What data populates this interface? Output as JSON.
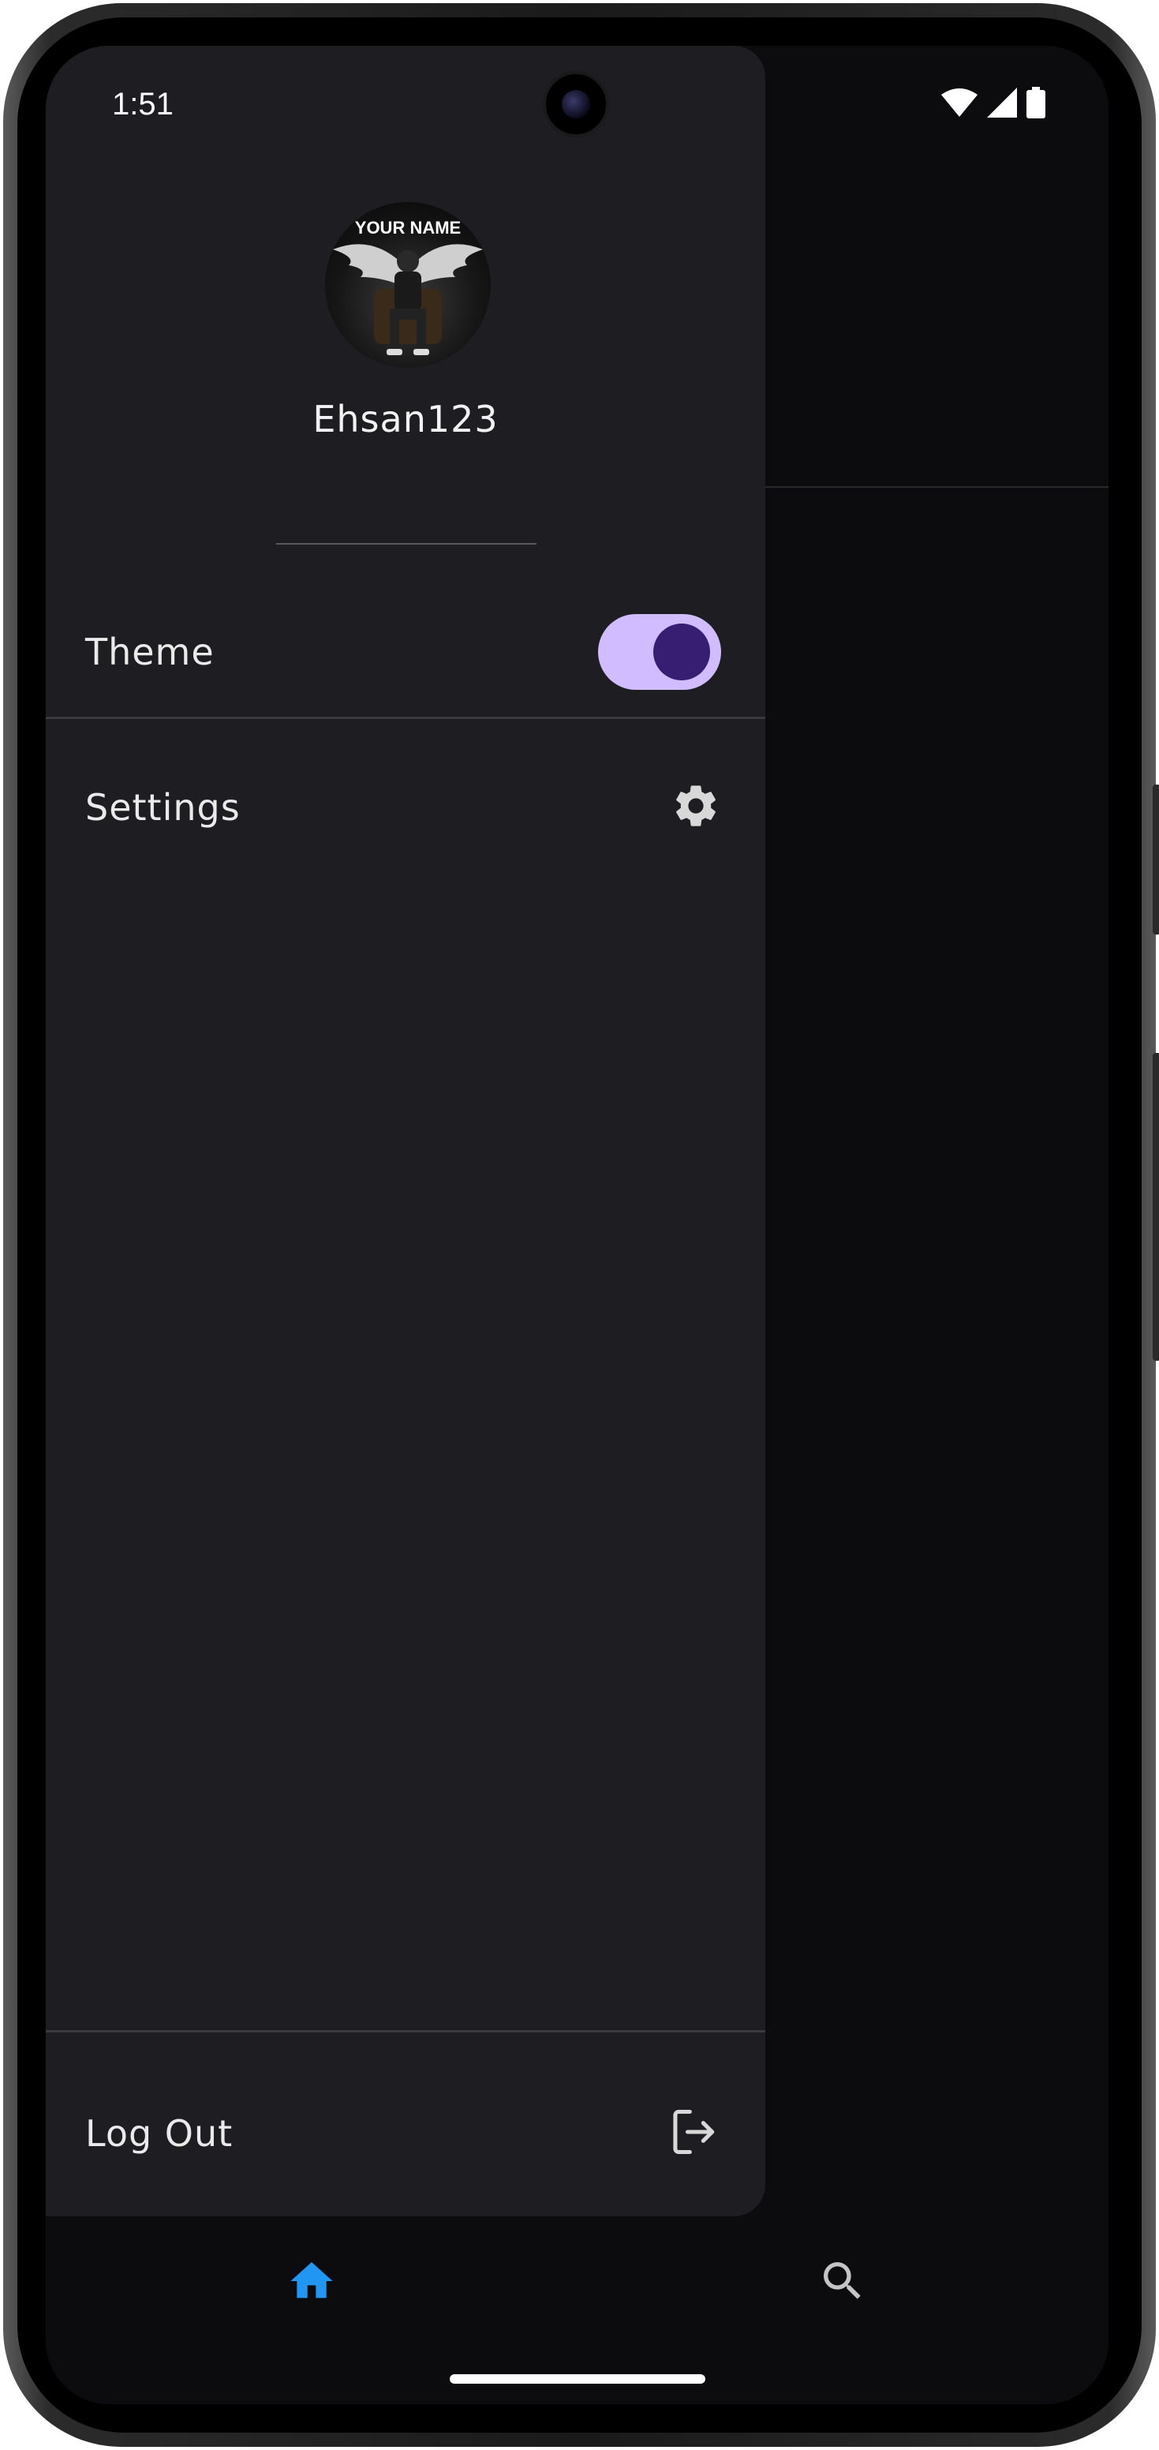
{
  "status_bar": {
    "time": "1:51",
    "icons": [
      "wifi-icon",
      "cellular-signal-icon",
      "battery-icon"
    ]
  },
  "drawer": {
    "avatar_text": "YOUR NAME",
    "username": "Ehsan123",
    "items": [
      {
        "label": "Theme",
        "control": "toggle",
        "toggle_on": true
      },
      {
        "label": "Settings",
        "icon": "gear-icon"
      }
    ],
    "logout": {
      "label": "Log Out",
      "icon": "logout-icon"
    }
  },
  "bottom_nav": {
    "items": [
      {
        "icon": "home-icon",
        "active": true
      },
      {
        "icon": "search-icon",
        "active": false
      }
    ]
  },
  "colors": {
    "drawer_bg": "#1e1d21",
    "toggle_track": "#d0bcff",
    "toggle_knob": "#381e72",
    "nav_active": "#2196f3",
    "nav_inactive": "#c4c4c4"
  }
}
